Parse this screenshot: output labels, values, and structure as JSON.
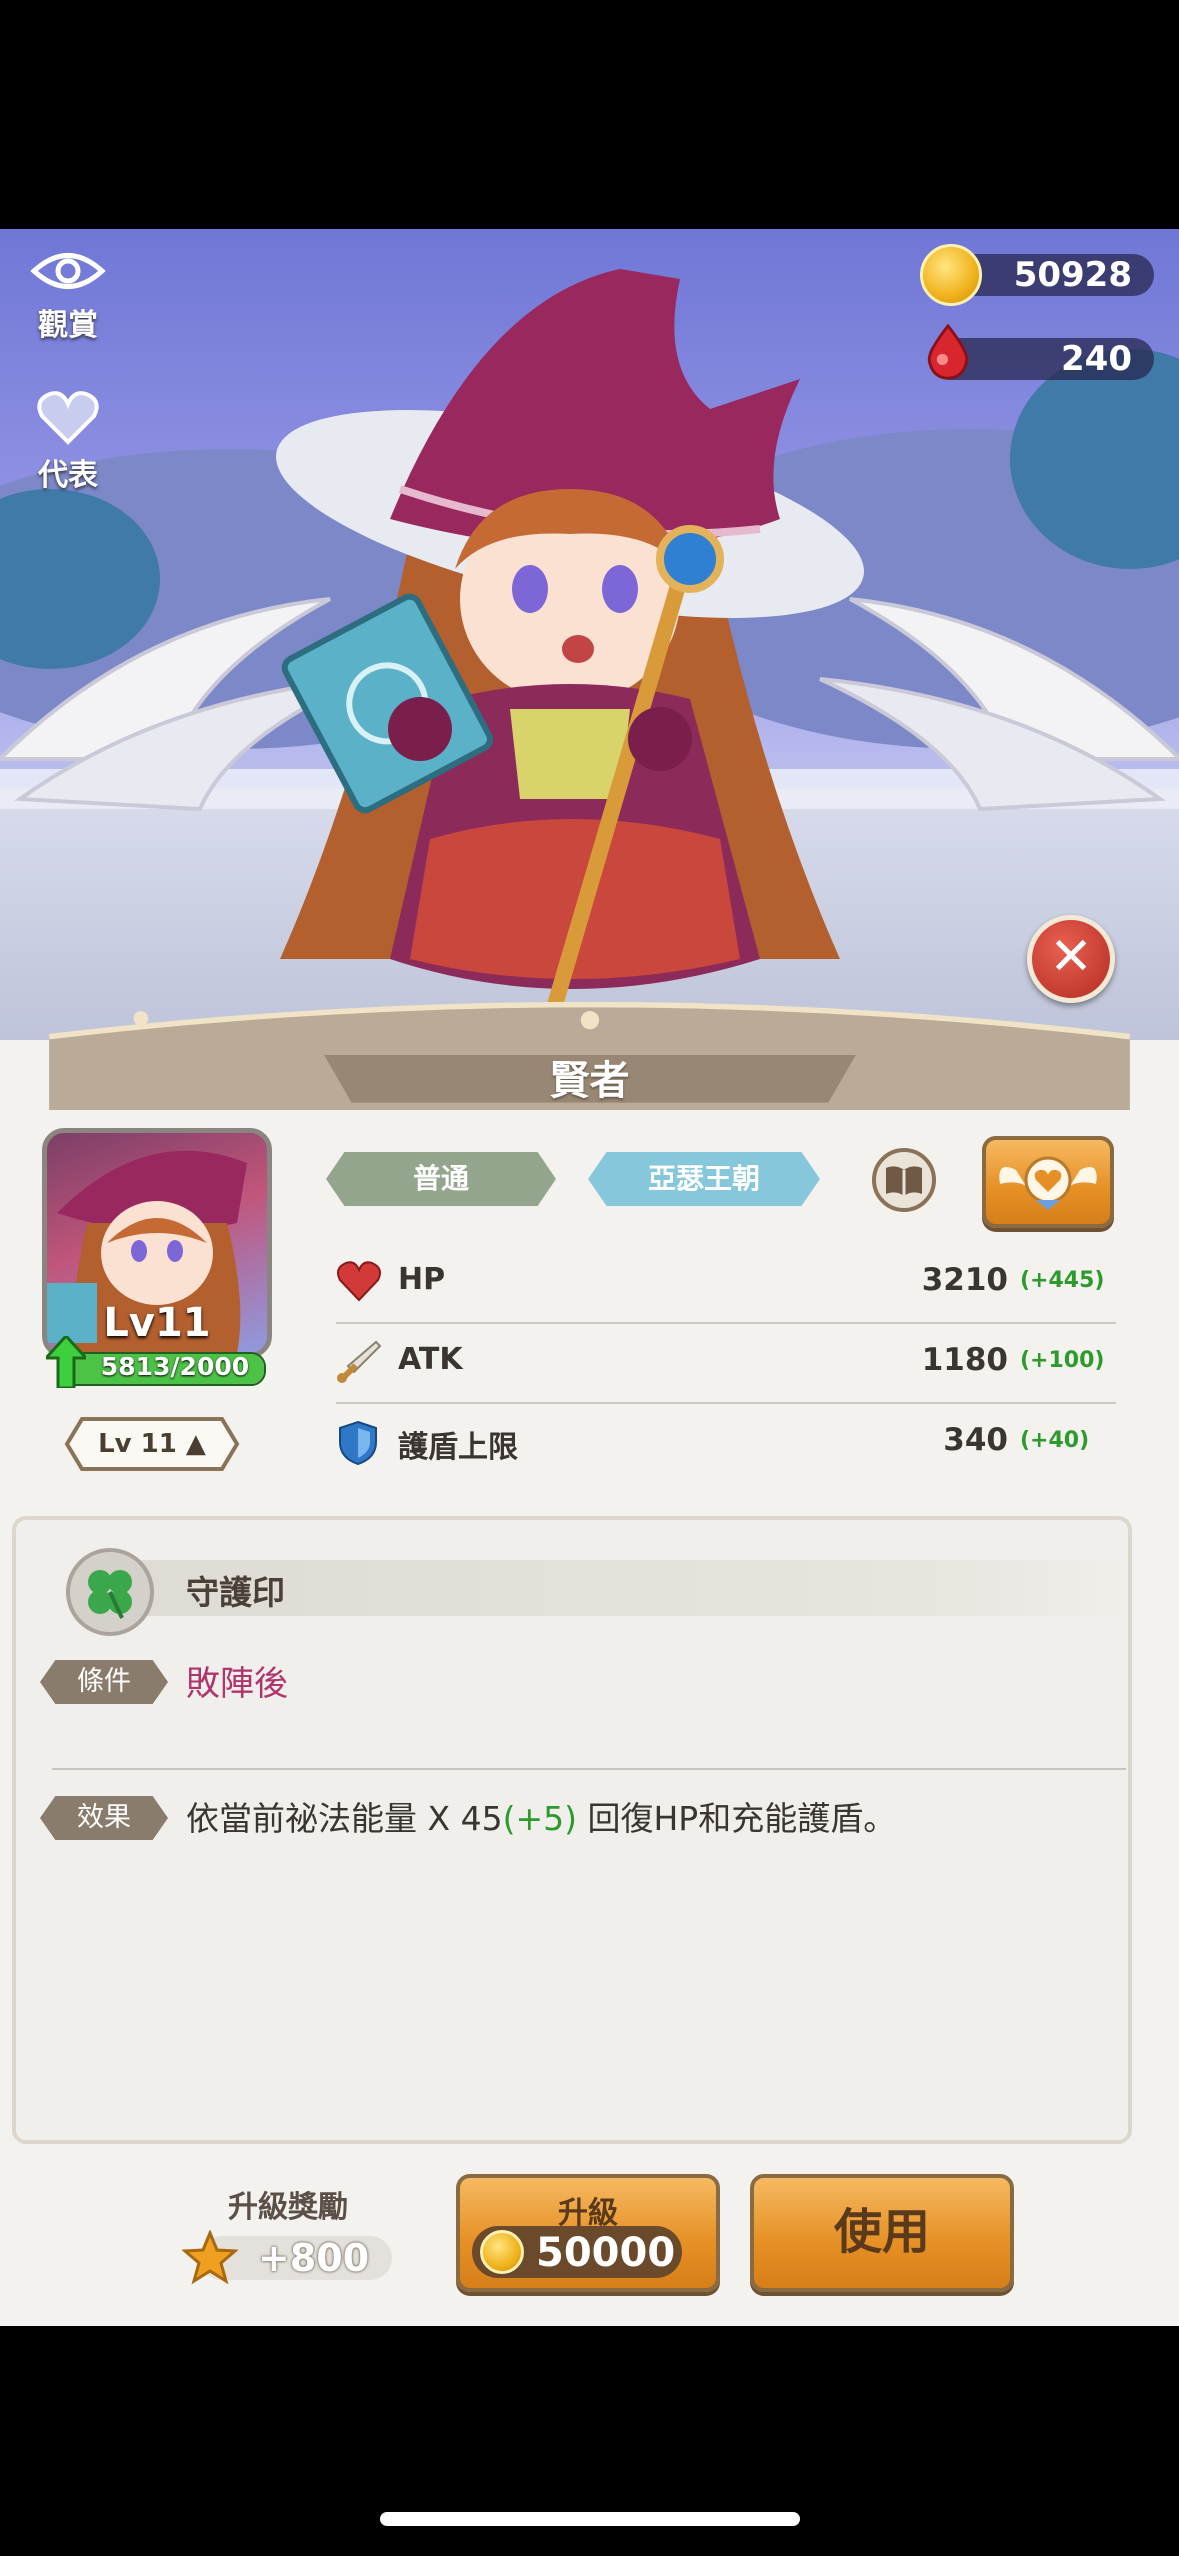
{
  "top_left": {
    "view_label": "觀賞",
    "represent_label": "代表"
  },
  "currency": {
    "gold": "50928",
    "gems": "240"
  },
  "character": {
    "name": "賢者",
    "level_label": "Lv11",
    "xp_text": "5813/2000",
    "xp_progress": 1.0,
    "level_button": "Lv 11 ▲",
    "rarity_tag": "普通",
    "faction_tag": "亞瑟王朝"
  },
  "stats": [
    {
      "name": "HP",
      "value": "3210",
      "bonus": "(+445)",
      "icon": "heart-icon"
    },
    {
      "name": "ATK",
      "value": "1180",
      "bonus": "(+100)",
      "icon": "sword-icon"
    },
    {
      "name": "護盾上限",
      "value": "340",
      "bonus": "(+40)",
      "icon": "shield-icon"
    }
  ],
  "skill": {
    "name": "守護印",
    "condition_label": "條件",
    "condition_value": "敗陣後",
    "effect_label": "效果",
    "effect_text_a": "依當前祕法能量 X 45",
    "effect_bonus": "(+5)",
    "effect_text_b": " 回復HP和充能護盾。"
  },
  "bottom": {
    "reward_label": "升級獎勵",
    "reward_value": "+800",
    "upgrade_label": "升級",
    "upgrade_cost": "50000",
    "use_label": "使用"
  },
  "colors": {
    "rarity_tag": "#93a58c",
    "faction_tag": "#86c7dc",
    "accent_orange": "#e58f24",
    "bonus_green": "#2d9a2d"
  }
}
